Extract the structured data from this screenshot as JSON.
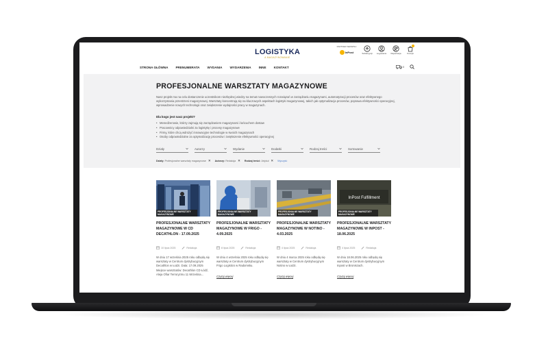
{
  "header": {
    "logo_main": "LOGISTYKA",
    "logo_sub": "A MAGAZYNOWANIE",
    "partner_label": "PARTNER SERWISU",
    "partner_name": "InPost",
    "icons": [
      {
        "label": "Subskrypcji",
        "icon": "subscription-icon"
      },
      {
        "label": "Logowanie",
        "icon": "user-icon"
      },
      {
        "label": "Rejestracja",
        "icon": "register-icon"
      },
      {
        "label": "Koszyk",
        "icon": "cart-icon"
      }
    ]
  },
  "nav": {
    "items": [
      "STRONA GŁÓWNA",
      "PRENUMERATA",
      "WYDANIA",
      "WYDARZENIA",
      "INNE",
      "KONTAKT"
    ],
    "cart_count": "0"
  },
  "intro": {
    "title": "PROFESJONALNE WARSZTATY MAGAZYNOWE",
    "description": "Nasz projekt ma na celu dostarczenie uczestnikom niezbędnej wiedzy na temat nowoczesnych rozwiązań w zarządzaniu magazynami, automatyzacji procesów oraz efektywnego wykorzystania przestrzeni magazynowej. Warsztaty koncentrują się na kluczowych aspektach logistyki magazynowej, takich jak optymalizacja procesów, poprawa efektywności operacyjnej, wprowadzenie nowych technologii oraz zwiększenie wydajności pracy w magazynach.",
    "audience_heading": "Dla kogo jest nasz projekt?",
    "audience": [
      "Menedżerowie, którzy zajmują się zarządzaniem magazynami i łańcuchem dostaw",
      "Pracownicy odpowiedzialni za logistykę i procesy magazynowe",
      "Firmy, które chcą wdrożyć innowacyjne technologie w swoich magazynach",
      "Osoby odpowiedzialne za optymalizację procesów i zwiększenie efektywności operacyjnej"
    ],
    "filters": [
      "Działy",
      "Autorzy",
      "Wydanie",
      "Dodatki",
      "Rodzaj treści",
      "Sortowanie"
    ],
    "active_filters": [
      {
        "key": "Działy:",
        "value": "Profesjonalne warsztaty magazynowe"
      },
      {
        "key": "Autorzy:",
        "value": "Redakcja"
      },
      {
        "key": "Rodzaj treści:",
        "value": "Artykuł"
      }
    ],
    "clear_label": "Wyczyść"
  },
  "cards": [
    {
      "category": "PROFESJONALNE WARSZTATY MAGAZYNOWE",
      "title": "PROFESJONALNE WARSZTATY MAGAZYNOWE W CD DECATHLON - 17.09.2025",
      "date": "10 lipca 2025",
      "author": "Redakcja",
      "description": "W dniu 17 września 2025 roku odbędą się warsztaty w Centrum dystrybucyjnym Decathlon w Łodzi. Data: 17.09.2025 Miejsce warsztatów: Decathlon CD Łódź, Aleja Ofiar Terroryzmu 11 Września...",
      "more": ""
    },
    {
      "category": "PROFESJONALNE WARSZTATY MAGAZYNOWE",
      "title": "PROFESJONALNE WARSZTATY MAGAZYNOWE W FRIGO - 4.09.2025",
      "date": "8 lipca 2025",
      "author": "Redakcja",
      "description": "W dniu 4 września 2025 roku odbędą się warsztaty w Centrum dystrybucyjnym Frigo Logistics w Radomsku.",
      "more": "Czytaj więcej"
    },
    {
      "category": "PROFESJONALNE WARSZTATY MAGAZYNOWE",
      "title": "PROFESJONALNE WARSZTATY MAGAZYNOWE W NOTINO - 4.03.2025",
      "date": "4 lipca 2025",
      "author": "Redakcja",
      "description": "W dniu 4 marca 2025 roku odbędą się warsztaty w Centrum dystrybucyjnym Notino w Łodzi.",
      "more": "Czytaj więcej"
    },
    {
      "category": "PROFESJONALNE WARSZTATY MAGAZYNOWE",
      "title": "PROFESJONALNE WARSZTATY MAGAZYNOWE W INPOST - 18.06.2025",
      "date": "4 lipca 2025",
      "author": "Redakcja",
      "description": "W dniu 18.06.2025 roku odbędą się warsztaty w Centrum dystrybucyjnym Inpost w Broniszach.",
      "more": "Czytaj więcej",
      "thumb_text": "InPost Fulfillment"
    }
  ],
  "colors": {
    "brand_navy": "#1a2a5c",
    "accent_yellow": "#f6b500",
    "panel_bg": "#f2f2f3",
    "laptop": "#1c1c1e"
  }
}
